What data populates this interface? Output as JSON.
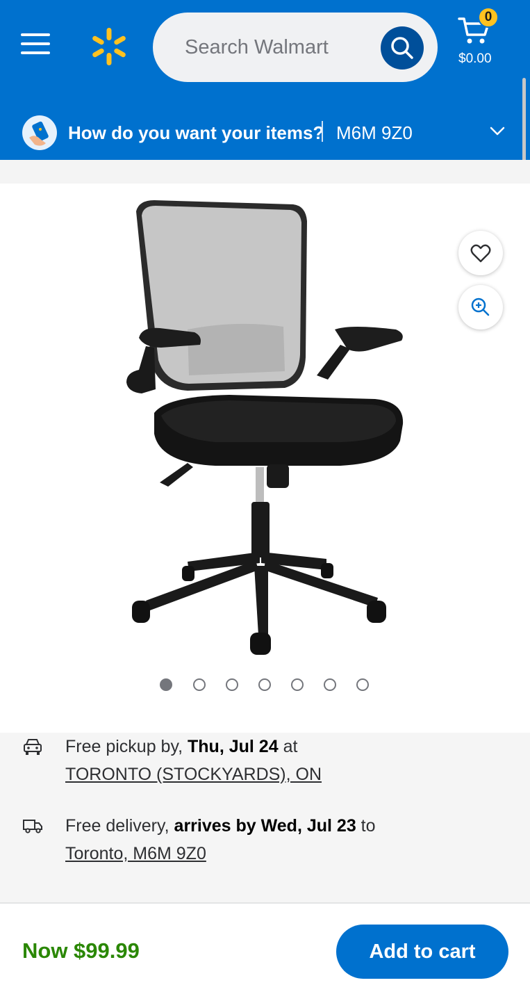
{
  "header": {
    "search_placeholder": "Search Walmart",
    "cart_count": "0",
    "cart_total": "$0.00",
    "brand_color": "#0071ce",
    "spark_color": "#ffc220"
  },
  "location": {
    "question": "How do you want your items?",
    "postal_code": "M6M 9Z0"
  },
  "gallery": {
    "image_count": 7,
    "active_index": 0,
    "actions": [
      "heart-icon",
      "zoom-in-icon"
    ]
  },
  "fulfillment": {
    "pickup": {
      "prefix": "Free pickup by,",
      "date": "Thu, Jul 24",
      "suffix": "at",
      "store": "TORONTO (STOCKYARDS), ON"
    },
    "delivery": {
      "prefix": "Free delivery,",
      "date": "arrives by Wed, Jul 23",
      "suffix": "to",
      "address": "Toronto, M6M 9Z0"
    }
  },
  "footer": {
    "price": "Now $99.99",
    "add_to_cart": "Add to cart",
    "price_color": "#2a8703"
  }
}
